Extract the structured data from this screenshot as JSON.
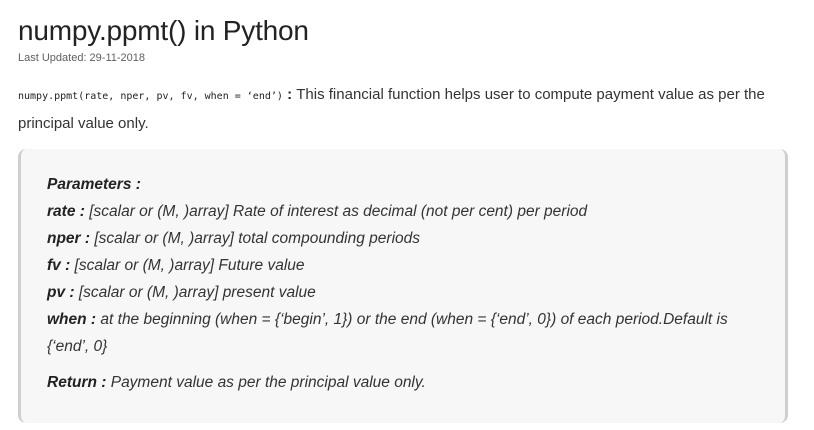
{
  "article": {
    "title": "numpy.ppmt() in Python",
    "last_updated": "Last Updated: 29-11-2018",
    "signature": "numpy.ppmt(rate, nper, pv, fv, when = ‘end’)",
    "separator": " : ",
    "description": "This financial function helps user to compute payment value as per the principal value only."
  },
  "params": {
    "heading": "Parameters :",
    "rate_name": "rate :",
    "rate_desc": " [scalar or (M, )array] Rate of interest as decimal (not per cent) per period",
    "nper_name": "nper :",
    "nper_desc": " [scalar or (M, )array] total compounding periods",
    "fv_name": "fv :",
    "fv_desc": " [scalar or (M, )array] Future value",
    "pv_name": "pv :",
    "pv_desc": " [scalar or (M, )array] present value",
    "when_name": "when :",
    "when_desc": " at the beginning (when = {‘begin’, 1}) or the end (when = {‘end’, 0}) of each period.Default is {‘end’, 0}",
    "return_name": "Return :",
    "return_desc": " Payment value as per the principal value only."
  }
}
